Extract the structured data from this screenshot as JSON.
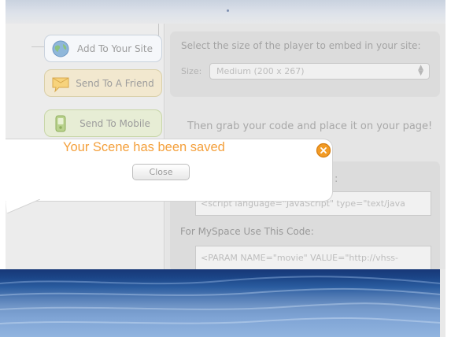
{
  "sidebar": {
    "items": [
      {
        "label": "Add To Your Site",
        "icon": "globe-icon"
      },
      {
        "label": "Send To A Friend",
        "icon": "message-bubble-icon"
      },
      {
        "label": "Send To Mobile",
        "icon": "mobile-phone-icon"
      }
    ]
  },
  "embed": {
    "title": "Select the size of the player to embed in your site:",
    "size_label": "Size:",
    "size_value": "Medium (200 x 267)",
    "grab_instruction": "Then grab your code and place it on your page!",
    "partial_label_end": ":",
    "code_field_1": "<script language=\"JavaScript\" type=\"text/java",
    "myspace_label": "For MySpace Use This Code:",
    "code_field_2": "<PARAM NAME=\"movie\" VALUE=\"http://vhss-"
  },
  "popup": {
    "message": "Your Scene has been saved",
    "close_label": "Close"
  },
  "colors": {
    "accent": "#f4a03c",
    "close_icon": "#f29b25",
    "water": "#2a5c9f"
  }
}
